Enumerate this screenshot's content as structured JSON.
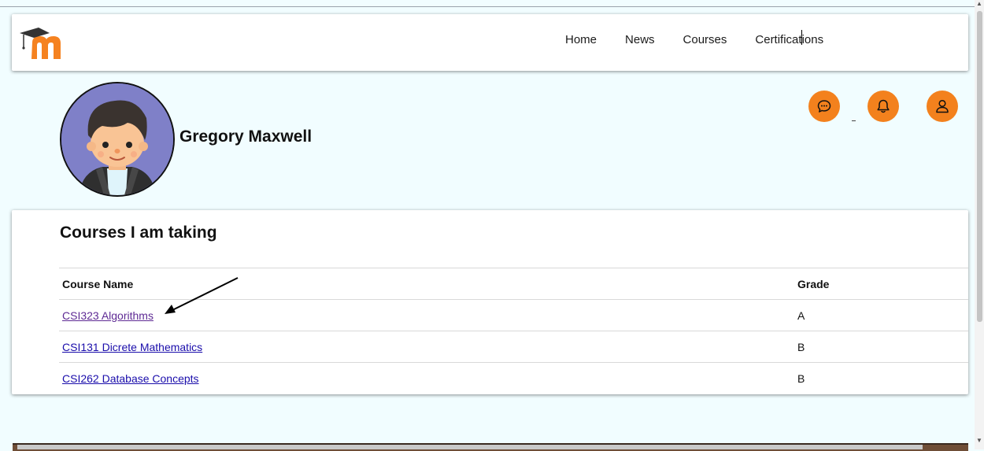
{
  "nav": {
    "links": [
      "Home",
      "News",
      "Courses",
      "Certifications"
    ]
  },
  "profile": {
    "name": "Gregory Maxwell"
  },
  "actions": {
    "icons": [
      "chat-icon",
      "bell-icon",
      "user-icon"
    ]
  },
  "courses": {
    "title": "Courses I am taking",
    "columns": [
      "Course Name",
      "Grade"
    ],
    "rows": [
      {
        "name": "CSI323 Algorithms",
        "grade": "A"
      },
      {
        "name": "CSI131 Dicrete Mathematics",
        "grade": "B"
      },
      {
        "name": "CSI262 Database Concepts",
        "grade": "B"
      }
    ]
  },
  "colors": {
    "page_background": "#f1fdff",
    "accent_orange": "#f3811d",
    "link_blue": "#1a0dab",
    "link_visited": "#5e2a94"
  }
}
